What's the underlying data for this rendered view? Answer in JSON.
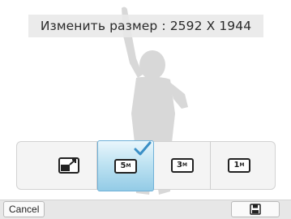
{
  "header": {
    "title": "Изменить размер : 2592 X 1944"
  },
  "size_options": [
    {
      "icon": "custom-resize-icon",
      "label": ""
    },
    {
      "icon": "resolution-5m-icon",
      "label": "5",
      "unit": "M",
      "selected": true
    },
    {
      "icon": "resolution-3m-icon",
      "label": "3",
      "unit": "M"
    },
    {
      "icon": "resolution-1m-icon",
      "label": "1",
      "unit": "M"
    }
  ],
  "footer": {
    "cancel_label": "Cancel",
    "save_icon": "save-icon"
  },
  "colors": {
    "selection_top": "#e9f6fc",
    "selection_bottom": "#93cbe6",
    "check": "#3a8fc6"
  }
}
